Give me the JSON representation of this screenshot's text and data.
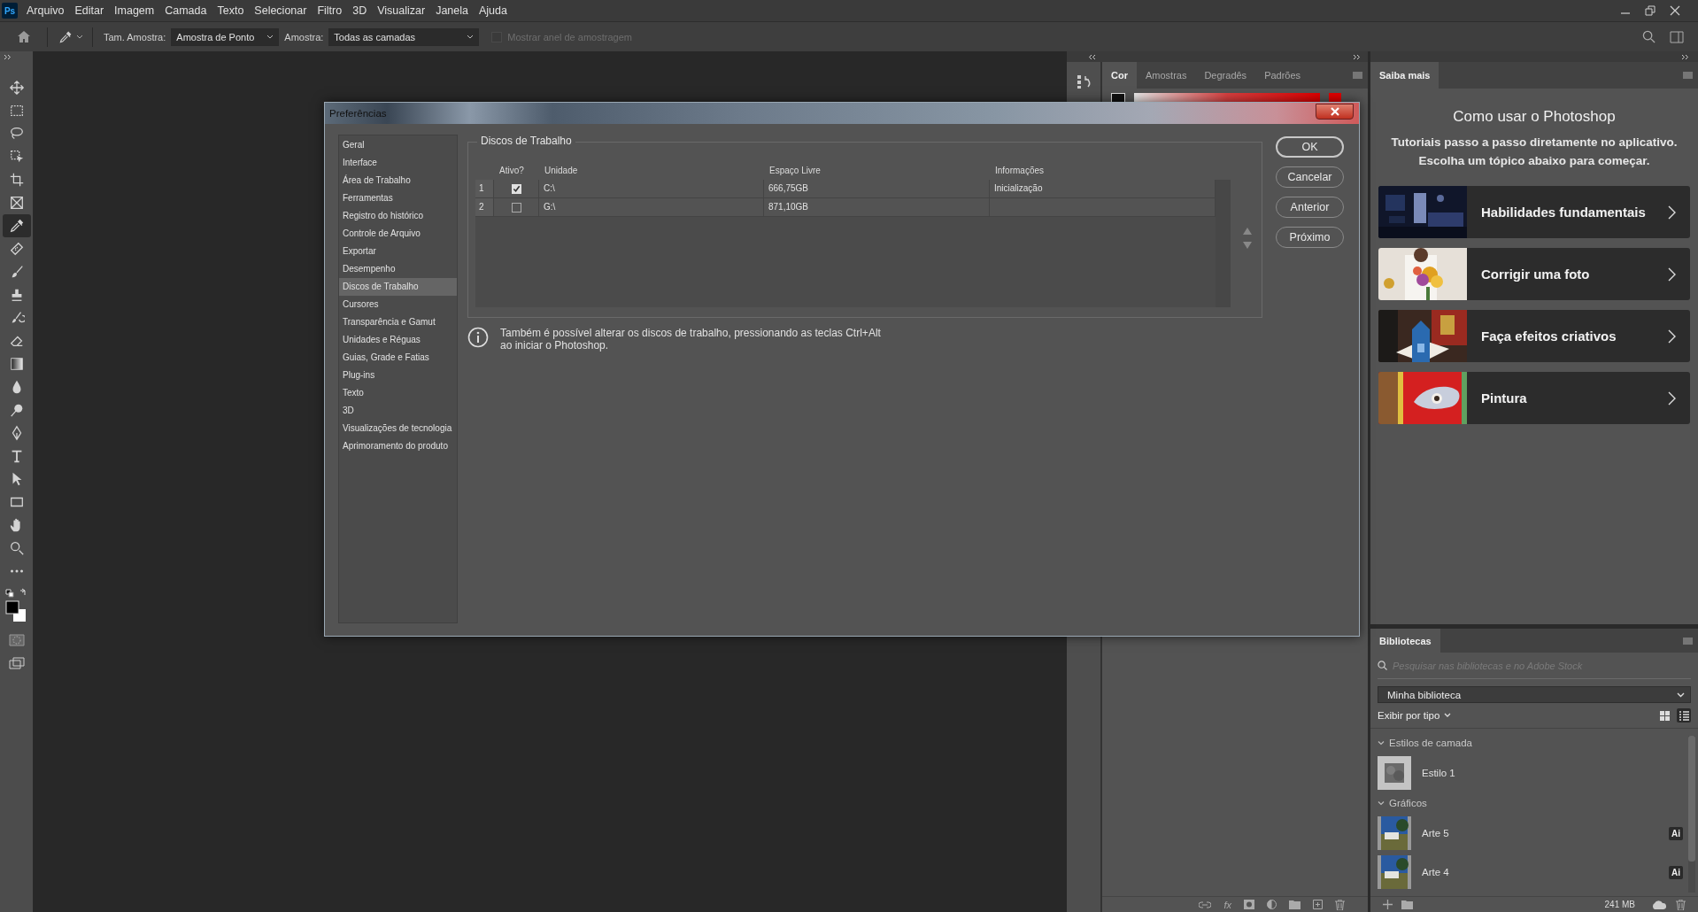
{
  "menu_bar": {
    "logo": "Ps",
    "items": [
      "Arquivo",
      "Editar",
      "Imagem",
      "Camada",
      "Texto",
      "Selecionar",
      "Filtro",
      "3D",
      "Visualizar",
      "Janela",
      "Ajuda"
    ]
  },
  "options_bar": {
    "sample_size_label": "Tam. Amostra:",
    "sample_size_value": "Amostra de Ponto",
    "sample_label": "Amostra:",
    "sample_value": "Todas as camadas",
    "show_ring": {
      "label": "Mostrar anel de amostragem",
      "checked": false,
      "disabled": true
    }
  },
  "tools": [
    {
      "kind": "move",
      "selected": false
    },
    {
      "kind": "marquee",
      "selected": false
    },
    {
      "kind": "lasso",
      "selected": false
    },
    {
      "kind": "object_select",
      "selected": false
    },
    {
      "kind": "crop",
      "selected": false
    },
    {
      "kind": "frame",
      "selected": false
    },
    {
      "kind": "eyedropper",
      "selected": true
    },
    {
      "kind": "healing",
      "selected": false
    },
    {
      "kind": "brush",
      "selected": false
    },
    {
      "kind": "stamp",
      "selected": false
    },
    {
      "kind": "history_brush",
      "selected": false
    },
    {
      "kind": "eraser",
      "selected": false
    },
    {
      "kind": "gradient",
      "selected": false
    },
    {
      "kind": "blur",
      "selected": false
    },
    {
      "kind": "dodge",
      "selected": false
    },
    {
      "kind": "pen",
      "selected": false
    },
    {
      "kind": "type",
      "selected": false
    },
    {
      "kind": "path_select",
      "selected": false
    },
    {
      "kind": "rectangle",
      "selected": false
    },
    {
      "kind": "hand",
      "selected": false
    },
    {
      "kind": "zoom",
      "selected": false
    },
    {
      "kind": "more",
      "selected": false
    }
  ],
  "color_panel": {
    "tabs": [
      {
        "label": "Cor",
        "selected": true
      },
      {
        "label": "Amostras",
        "selected": false
      },
      {
        "label": "Degradês",
        "selected": false
      },
      {
        "label": "Padrões",
        "selected": false
      }
    ]
  },
  "layers_footer": {
    "effects_label": "fx"
  },
  "learn_panel": {
    "tab": {
      "label": "Saiba mais",
      "selected": true
    },
    "title": "Como usar o Photoshop",
    "subtitle": [
      "Tutoriais passo a passo diretamente no aplicativo.",
      "Escolha um tópico abaixo para começar."
    ],
    "topics": [
      {
        "label": "Habilidades fundamentais"
      },
      {
        "label": "Corrigir uma foto"
      },
      {
        "label": "Faça efeitos criativos"
      },
      {
        "label": "Pintura"
      }
    ]
  },
  "libraries_panel": {
    "tab": {
      "label": "Bibliotecas",
      "selected": true
    },
    "search_placeholder": "Pesquisar nas bibliotecas e no Adobe Stock",
    "library": "Minha biblioteca",
    "view_by": "Exibir por tipo",
    "view_modes": [
      {
        "kind": "grid",
        "selected": false
      },
      {
        "kind": "list",
        "selected": true
      }
    ],
    "sections": [
      {
        "title": "Estilos de camada",
        "expanded": true,
        "items": [
          {
            "name": "Estilo 1",
            "kind": "style"
          }
        ]
      },
      {
        "title": "Gráficos",
        "expanded": true,
        "items": [
          {
            "name": "Arte 5",
            "kind": "graphic",
            "badge": "Ai"
          },
          {
            "name": "Arte 4",
            "kind": "graphic",
            "badge": "Ai"
          }
        ]
      }
    ],
    "storage": "241 MB"
  },
  "dialog": {
    "title": "Preferências",
    "categories": [
      {
        "label": "Geral",
        "selected": false
      },
      {
        "label": "Interface",
        "selected": false
      },
      {
        "label": "Área de Trabalho",
        "selected": false
      },
      {
        "label": "Ferramentas",
        "selected": false
      },
      {
        "label": "Registro do histórico",
        "selected": false
      },
      {
        "label": "Controle de Arquivo",
        "selected": false
      },
      {
        "label": "Exportar",
        "selected": false
      },
      {
        "label": "Desempenho",
        "selected": false
      },
      {
        "label": "Discos de Trabalho",
        "selected": true
      },
      {
        "label": "Cursores",
        "selected": false
      },
      {
        "label": "Transparência e Gamut",
        "selected": false
      },
      {
        "label": "Unidades e Réguas",
        "selected": false
      },
      {
        "label": "Guias, Grade e Fatias",
        "selected": false
      },
      {
        "label": "Plug-ins",
        "selected": false
      },
      {
        "label": "Texto",
        "selected": false
      },
      {
        "label": "3D",
        "selected": false
      },
      {
        "label": "Visualizações de tecnologia",
        "selected": false
      },
      {
        "label": "Aprimoramento do produto",
        "selected": false
      }
    ],
    "group_title": "Discos de Trabalho",
    "columns": [
      "Ativo?",
      "Unidade",
      "Espaço Livre",
      "Informações"
    ],
    "rows": [
      {
        "index": "1",
        "active": true,
        "drive": "C:\\",
        "free": "666,75GB",
        "info": "Inicialização"
      },
      {
        "index": "2",
        "active": false,
        "drive": "G:\\",
        "free": "871,10GB"
      }
    ],
    "note": [
      "Também é possível alterar os discos de trabalho, pressionando as teclas Ctrl+Alt",
      "ao iniciar o Photoshop."
    ],
    "buttons": [
      {
        "label": "OK",
        "default": true
      },
      {
        "label": "Cancelar",
        "default": false
      },
      {
        "label": "Anterior",
        "default": false
      },
      {
        "label": "Próximo",
        "default": false
      }
    ]
  }
}
